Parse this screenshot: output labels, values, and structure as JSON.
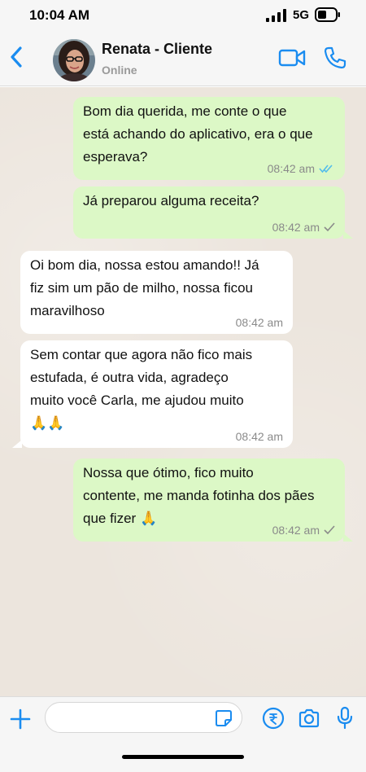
{
  "status_bar": {
    "time": "10:04 AM",
    "network": "5G"
  },
  "header": {
    "contact_name": "Renata - Cliente",
    "contact_status": "Online",
    "icons": [
      "back-chevron-icon",
      "video-call-icon",
      "phone-icon"
    ]
  },
  "colors": {
    "accent": "#1a8cf0",
    "outgoing_bubble": "#dcf8c6",
    "incoming_bubble": "#ffffff",
    "chat_background": "#ece5dd",
    "read_ticks": "#53bdeb",
    "sent_tick": "#8a8a8a"
  },
  "messages": [
    {
      "direction": "outgoing",
      "lines": [
        "Bom dia querida, me conte o que",
        "está achando do aplicativo, era o que",
        "esperava?"
      ],
      "time": "08:42 am",
      "status": "read"
    },
    {
      "direction": "outgoing",
      "lines": [
        "Já preparou alguma receita?"
      ],
      "time": "08:42 am",
      "status": "sent"
    },
    {
      "direction": "incoming",
      "lines": [
        "Oi bom dia, nossa estou amando!! Já",
        "fiz sim um pão de milho, nossa ficou",
        "maravilhoso"
      ],
      "time": "08:42 am"
    },
    {
      "direction": "incoming",
      "lines": [
        "Sem contar que agora não fico mais",
        "estufada, é outra vida, agradeço",
        "muito você Carla, me ajudou muito"
      ],
      "emoji": "🙏🙏",
      "time": "08:42 am"
    },
    {
      "direction": "outgoing",
      "lines": [
        "Nossa que ótimo, fico muito",
        "contente, me manda fotinha dos pães",
        "que fizer"
      ],
      "emoji": "🙏",
      "time": "08:42 am",
      "status": "sent"
    }
  ],
  "composer": {
    "input_value": "",
    "placeholder": "",
    "icons": [
      "plus-icon",
      "sticker-icon",
      "payment-icon",
      "camera-icon",
      "microphone-icon"
    ]
  }
}
